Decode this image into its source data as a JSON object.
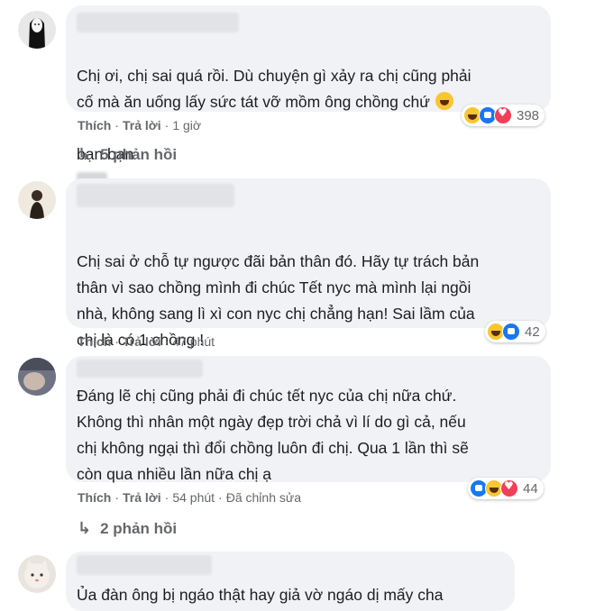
{
  "actions": {
    "like": "Thích",
    "reply": "Trả lời",
    "edited": "Đã chỉnh sửa"
  },
  "comments": [
    {
      "avatar_icon": "no-face-avatar-icon",
      "text": "Chị ơi, chị sai quá rồi. Dù chuyện gì xảy ra chị cũng phải\ncố mà ăn uống lấy sức tát vỡ mồm ông chồng chứ",
      "text_tail": "bạn bạn",
      "time": "1 giờ",
      "reaction_count": "398",
      "reactions": [
        "haha",
        "like",
        "love"
      ],
      "replies": "5 phản hồi"
    },
    {
      "avatar_icon": "person-avatar-icon",
      "text": "Chị sai ở chỗ tự ngược đãi bản thân đó. Hãy tự trách bản\nthân vì sao chồng mình đi chúc Tết nyc mà mình lại ngồi\nnhà, không sang lì xì con nyc chị chẳng hạn! Sai lầm của\nchị là có 1 chồng !",
      "time": "47 phút",
      "reaction_count": "42",
      "reactions": [
        "haha",
        "like"
      ]
    },
    {
      "avatar_icon": "person-avatar-icon",
      "text": "Đáng lẽ chị cũng phải đi chúc tết nyc của chị nữa chứ.\nKhông thì nhân một ngày đẹp trời chả vì lí do gì cả, nếu\nchị không ngại thì đổi chồng luôn đi chị. Qua 1 lần thì sẽ\ncòn qua nhiều lần nữa chị ạ",
      "time": "54 phút",
      "reaction_count": "44",
      "reactions": [
        "like",
        "haha",
        "love"
      ],
      "replies": "2 phản hồi"
    },
    {
      "avatar_icon": "cat-avatar-icon",
      "text": "Ủa đàn ông bị ngáo thật hay giả vờ ngáo dị mấy cha"
    }
  ]
}
